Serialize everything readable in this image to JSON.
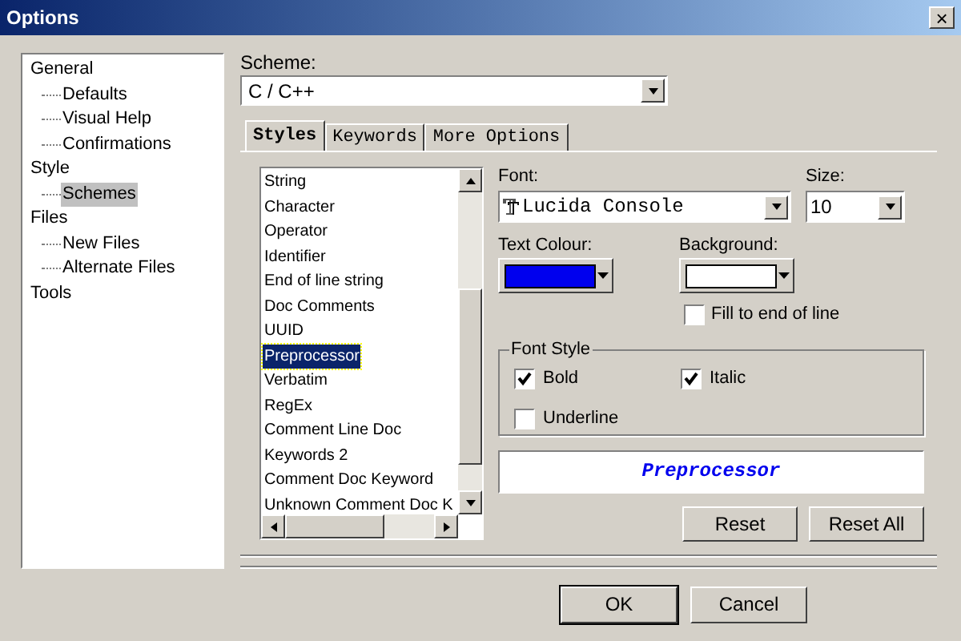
{
  "window": {
    "title": "Options",
    "close": "×"
  },
  "tree": [
    {
      "label": "General",
      "selected": false,
      "children": [
        {
          "label": "Defaults",
          "selected": false
        },
        {
          "label": "Visual Help",
          "selected": false
        },
        {
          "label": "Confirmations",
          "selected": false
        }
      ]
    },
    {
      "label": "Style",
      "selected": false,
      "children": [
        {
          "label": "Schemes",
          "selected": true
        }
      ]
    },
    {
      "label": "Files",
      "selected": false,
      "children": [
        {
          "label": "New Files",
          "selected": false
        },
        {
          "label": "Alternate Files",
          "selected": false
        }
      ]
    },
    {
      "label": "Tools",
      "selected": false
    }
  ],
  "scheme": {
    "label": "Scheme:",
    "value": "C / C++"
  },
  "tabs": [
    {
      "label": "Styles",
      "selected": true
    },
    {
      "label": "Keywords",
      "selected": false
    },
    {
      "label": "More Options",
      "selected": false
    }
  ],
  "styles": [
    {
      "label": "String",
      "selected": false
    },
    {
      "label": "Character",
      "selected": false
    },
    {
      "label": "Operator",
      "selected": false
    },
    {
      "label": "Identifier",
      "selected": false
    },
    {
      "label": "End of line string",
      "selected": false
    },
    {
      "label": "Doc Comments",
      "selected": false
    },
    {
      "label": "UUID",
      "selected": false
    },
    {
      "label": "Preprocessor",
      "selected": true
    },
    {
      "label": "Verbatim",
      "selected": false
    },
    {
      "label": "RegEx",
      "selected": false
    },
    {
      "label": "Comment Line Doc",
      "selected": false
    },
    {
      "label": "Keywords 2",
      "selected": false
    },
    {
      "label": "Comment Doc Keyword",
      "selected": false
    },
    {
      "label": "Unknown Comment Doc K",
      "selected": false
    }
  ],
  "font": {
    "label": "Font:",
    "value": "Lucida Console"
  },
  "size": {
    "label": "Size:",
    "value": "10"
  },
  "text_colour": {
    "label": "Text Colour:",
    "color": "#0000ee"
  },
  "background": {
    "label": "Background:",
    "color": "#ffffff"
  },
  "fill_to_end": {
    "label": "Fill to end of line",
    "checked": false
  },
  "font_style": {
    "label": "Font Style",
    "options": [
      {
        "label": "Bold",
        "checked": true
      },
      {
        "label": "Italic",
        "checked": true
      },
      {
        "label": "Underline",
        "checked": false
      }
    ]
  },
  "preview": {
    "text": "Preprocessor"
  },
  "buttons": [
    "Reset",
    "Reset All"
  ],
  "dialog_buttons": [
    "OK",
    "Cancel"
  ]
}
